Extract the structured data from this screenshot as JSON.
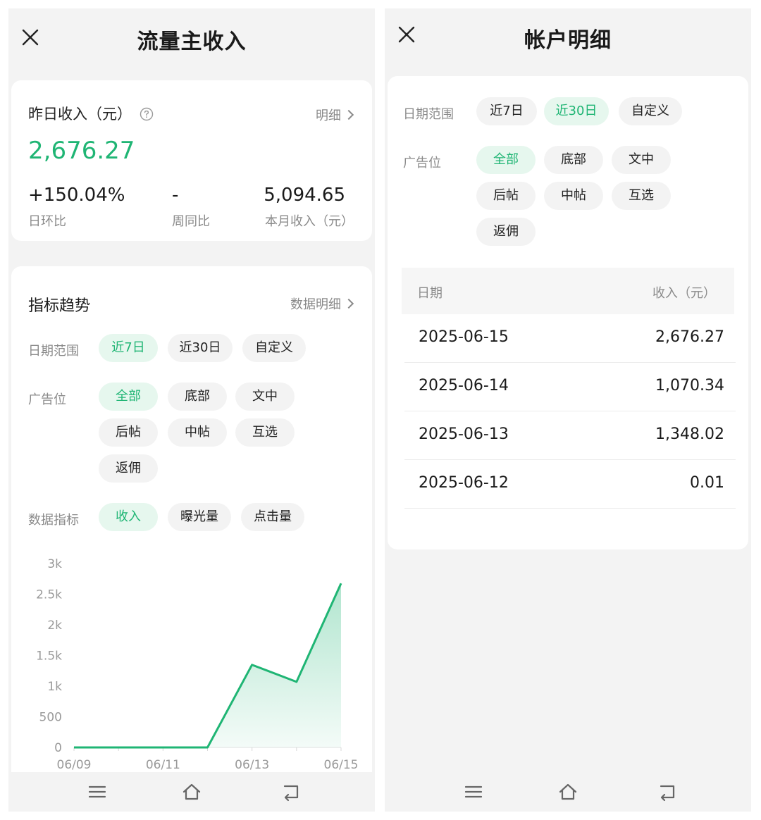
{
  "left": {
    "title": "流量主收入",
    "yesterday": {
      "label": "昨日收入（元）",
      "detail_link": "明细",
      "amount": "2,676.27",
      "stats": [
        {
          "value": "+150.04%",
          "label": "日环比"
        },
        {
          "value": "-",
          "label": "周同比"
        },
        {
          "value": "5,094.65",
          "label": "本月收入（元）"
        }
      ]
    },
    "trend": {
      "title": "指标趋势",
      "detail_link": "数据明细",
      "date_range_label": "日期范围",
      "date_range_options": [
        "近7日",
        "近30日",
        "自定义"
      ],
      "date_range_selected": "近7日",
      "ad_slot_label": "广告位",
      "ad_slot_options": [
        "全部",
        "底部",
        "文中",
        "后帖",
        "中帖",
        "互选",
        "返佣"
      ],
      "ad_slot_selected": "全部",
      "metric_label": "数据指标",
      "metric_options": [
        "收入",
        "曝光量",
        "点击量"
      ],
      "metric_selected": "收入"
    }
  },
  "right": {
    "title": "帐户明细",
    "date_range_label": "日期范围",
    "date_range_options": [
      "近7日",
      "近30日",
      "自定义"
    ],
    "date_range_selected": "近30日",
    "ad_slot_label": "广告位",
    "ad_slot_options": [
      "全部",
      "底部",
      "文中",
      "后帖",
      "中帖",
      "互选",
      "返佣"
    ],
    "ad_slot_selected": "全部",
    "table": {
      "headers": [
        "日期",
        "收入（元）"
      ],
      "rows": [
        {
          "date": "2025-06-15",
          "income": "2,676.27"
        },
        {
          "date": "2025-06-14",
          "income": "1,070.34"
        },
        {
          "date": "2025-06-13",
          "income": "1,348.02"
        },
        {
          "date": "2025-06-12",
          "income": "0.01"
        }
      ]
    }
  },
  "colors": {
    "accent": "#1fb574",
    "accent_bg": "#e6f7ee",
    "page_bg": "#f3f3f3",
    "card_bg": "#ffffff",
    "muted_text": "#8a8a8a"
  },
  "icons": {
    "close": "close-icon",
    "help": "question-circle-icon",
    "chevron": "chevron-right-icon",
    "nav": [
      "menu-icon",
      "home-icon",
      "back-icon"
    ]
  },
  "chart_data": {
    "type": "area",
    "x": [
      "06/09",
      "06/10",
      "06/11",
      "06/12",
      "06/13",
      "06/14",
      "06/15"
    ],
    "x_tick_labels": [
      "06/09",
      "06/11",
      "06/13",
      "06/15"
    ],
    "values": [
      0,
      0,
      0,
      0.01,
      1348.02,
      1070.34,
      2676.27
    ],
    "y_ticks": [
      "0",
      "500",
      "1k",
      "1.5k",
      "2k",
      "2.5k",
      "3k"
    ],
    "ylim": [
      0,
      3000
    ],
    "grid": false,
    "legend": "none"
  }
}
